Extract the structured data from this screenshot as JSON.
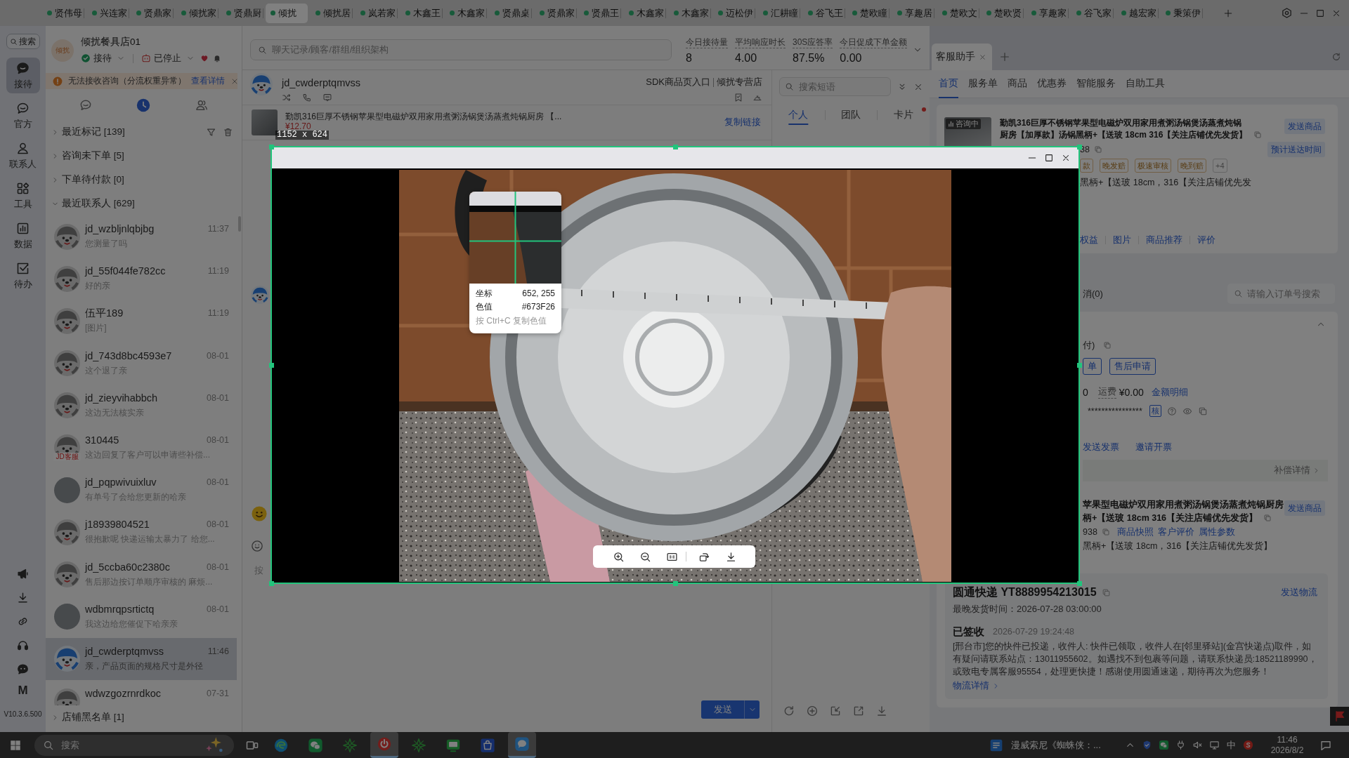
{
  "tab_bar": {
    "tabs": [
      {
        "label": "贤伟母",
        "selected": false
      },
      {
        "label": "兴连家",
        "selected": false
      },
      {
        "label": "贤鼎家",
        "selected": false
      },
      {
        "label": "倾扰家",
        "selected": false
      },
      {
        "label": "贤鼎厨",
        "selected": false
      },
      {
        "label": "倾扰",
        "selected": true
      },
      {
        "label": "倾扰居",
        "selected": false
      },
      {
        "label": "岚若家",
        "selected": false
      },
      {
        "label": "木鑫王",
        "selected": false
      },
      {
        "label": "木鑫家",
        "selected": false
      },
      {
        "label": "贤鼎桌",
        "selected": false
      },
      {
        "label": "贤鼎家",
        "selected": false
      },
      {
        "label": "贤鼎王",
        "selected": false
      },
      {
        "label": "木鑫家",
        "selected": false
      },
      {
        "label": "木鑫家",
        "selected": false
      },
      {
        "label": "迈松伊",
        "selected": false
      },
      {
        "label": "汇耕瞳",
        "selected": false
      },
      {
        "label": "谷飞王",
        "selected": false
      },
      {
        "label": "楚欧瞳",
        "selected": false
      },
      {
        "label": "享趣居",
        "selected": false
      },
      {
        "label": "楚欧文",
        "selected": false
      },
      {
        "label": "楚欧贤",
        "selected": false
      },
      {
        "label": "享趣家",
        "selected": false
      },
      {
        "label": "谷飞家",
        "selected": false
      },
      {
        "label": "越宏家",
        "selected": false
      },
      {
        "label": "秉策伊",
        "selected": false
      }
    ]
  },
  "rail": {
    "search": "搜索",
    "items": [
      {
        "label": "接待",
        "selected": true
      },
      {
        "label": "官方",
        "selected": false
      },
      {
        "label": "联系人",
        "selected": false
      },
      {
        "label": "工具",
        "selected": false
      },
      {
        "label": "数据",
        "selected": false
      },
      {
        "label": "待办",
        "selected": false
      }
    ],
    "brand": "M",
    "version": "V10.3.6.500"
  },
  "shop": {
    "avatar_label": "倾扰",
    "name": "倾扰餐具店01",
    "status": "接待",
    "mode": "已停止"
  },
  "notice": {
    "text": "无法接收咨询（分流权重异常）",
    "link": "查看详情"
  },
  "list_tabs": [
    {
      "selected": false
    },
    {
      "selected": true
    },
    {
      "selected": false
    }
  ],
  "groups": [
    {
      "label": "最近标记 [139]",
      "expanded": false
    },
    {
      "label": "咨询未下单 [5]",
      "expanded": false
    },
    {
      "label": "下单待付款 [0]",
      "expanded": false
    },
    {
      "label": "最近联系人 [629]",
      "expanded": true
    }
  ],
  "contacts": [
    {
      "name": "jd_wzbljnlqbjbg",
      "time": "11:37",
      "preview": "您测量了吗",
      "selected": false,
      "avatar": {
        "kind": "mascot"
      }
    },
    {
      "name": "jd_55f044fe782cc",
      "time": "11:19",
      "preview": "好的亲",
      "selected": false,
      "avatar": {
        "kind": "mascot"
      }
    },
    {
      "name": "伍平189",
      "time": "11:19",
      "preview": "[图片]",
      "selected": false,
      "avatar": {
        "kind": "mascot"
      }
    },
    {
      "name": "jd_743d8bc4593e7",
      "time": "08-01",
      "preview": "这个退了亲",
      "selected": false,
      "avatar": {
        "kind": "mascot"
      }
    },
    {
      "name": "jd_zieyvihabbch",
      "time": "08-01",
      "preview": "这边无法核实亲",
      "selected": false,
      "avatar": {
        "kind": "mascot"
      }
    },
    {
      "name": "310445",
      "time": "08-01",
      "preview": "这边回复了客户可以申请些补偿...",
      "selected": false,
      "avatar": {
        "kind": "service",
        "label": "JD客服"
      }
    },
    {
      "name": "jd_pqpwivuixluv",
      "time": "08-01",
      "preview": "有单号了会给您更新的哈亲",
      "selected": false,
      "avatar": {
        "kind": "photo"
      }
    },
    {
      "name": "j18939804521",
      "time": "08-01",
      "preview": "很抱歉呢 快递运输太暴力了 给您...",
      "selected": false,
      "avatar": {
        "kind": "mascot"
      }
    },
    {
      "name": "jd_5ccba60c2380c",
      "time": "08-01",
      "preview": "售后那边按订单顺序审核的 麻烦...",
      "selected": false,
      "avatar": {
        "kind": "mascot"
      }
    },
    {
      "name": "wdbmrqpsrtictq",
      "time": "08-01",
      "preview": "我这边给您催促下哈亲亲",
      "selected": false,
      "avatar": {
        "kind": "photo"
      }
    },
    {
      "name": "jd_cwderptqmvss",
      "time": "11:46",
      "preview": "亲，产品页面的规格尺寸是外径",
      "selected": true,
      "avatar": {
        "kind": "color"
      }
    },
    {
      "name": "wdwzgozrnrdkoc",
      "time": "07-31",
      "selected": false,
      "avatar": {
        "kind": "mascot"
      }
    }
  ],
  "blacklist": {
    "label": "店铺黑名单 [1]",
    "expanded": false
  },
  "workspace": {
    "search_placeholder": "聊天记录/顾客/群组/组织架构",
    "stats": [
      {
        "label": "今日接待量",
        "value": "8"
      },
      {
        "label": "平均响应时长",
        "value": "4.00"
      },
      {
        "label": "30S应答率",
        "value": "87.5%"
      },
      {
        "label": "今日促成下单金额",
        "value": "0.00"
      }
    ]
  },
  "chat": {
    "customer": "jd_cwderptqmvss",
    "entry": "SDK商品页入口",
    "store": "倾扰专营店",
    "product": {
      "title": "勤凯316巨厚不锈钢苹果型电磁炉双用家用煮粥汤锅煲汤蒸煮炖锅厨房 【...",
      "price": "¥12.70",
      "action": "复制链接"
    },
    "input_hint": "按",
    "send": "发送"
  },
  "quick_replies": {
    "placeholder": "搜索短语",
    "tabs": [
      {
        "label": "个人",
        "selected": true,
        "unread": false
      },
      {
        "label": "团队",
        "selected": false,
        "unread": false
      },
      {
        "label": "卡片",
        "selected": false,
        "unread": true
      }
    ]
  },
  "assistant": {
    "tabs": [
      {
        "label": "客服助手",
        "selected": true
      }
    ],
    "nav": [
      {
        "label": "首页",
        "selected": true
      },
      {
        "label": "服务单",
        "selected": false
      },
      {
        "label": "商品",
        "selected": false
      },
      {
        "label": "优惠券",
        "selected": false
      },
      {
        "label": "智能服务",
        "selected": false
      },
      {
        "label": "自助工具",
        "selected": false
      }
    ],
    "product": {
      "badge": "咨询中",
      "title": "勤凯316巨厚不锈钢苹果型电磁炉双用家用煮粥汤锅煲汤蒸煮炖锅厨房【加厚款】汤锅黑柄+【送玻 18cm 316【关注店铺优先发货】",
      "send": "发送商品",
      "eta": "预计送达时间",
      "sku": "38",
      "tags": [
        {
          "label": "款",
          "kind": "service"
        },
        {
          "label": "晚发赔",
          "kind": "service"
        },
        {
          "label": "极速审核",
          "kind": "service"
        },
        {
          "label": "晚到赔",
          "kind": "service"
        },
        {
          "label": "+4",
          "kind": "more"
        }
      ],
      "spec": "黑柄+【送玻 18cm，316【关注店铺优先发",
      "links": [
        "权益",
        "图片",
        "商品推荐",
        "评价"
      ]
    },
    "orders": {
      "filter": "消(0)",
      "placeholder": "请输入订单号搜索",
      "status": "付)",
      "actions": [
        "单",
        "售后申请"
      ],
      "amount": "0",
      "freight_label": "运费",
      "freight": "¥0.00",
      "detail": "金额明细",
      "masked": "****************",
      "verify": "核",
      "invoice": [
        "发送发票",
        "邀请开票"
      ],
      "compensation": "补偿详情"
    },
    "item": {
      "title": "苹果型电磁炉双用家用煮粥汤锅煲汤蒸煮炖锅厨房",
      "send": "发送商品",
      "variant": "柄+【送玻 18cm 316【关注店铺优先发货】",
      "sku": "938",
      "links": [
        "商品快照",
        "客户评价",
        "属性参数"
      ],
      "spec": "黑柄+【送玻 18cm，316【关注店铺优先发货】"
    },
    "logistics": {
      "carrier": "圆通快递 YT8889954213015",
      "send": "发送物流",
      "deadline": "最晚发货时间：2026-07-28 03:00:00",
      "status": "已签收",
      "status_time": "2026-07-29 19:24:48",
      "detail": "[邢台市]您的快件已投递，收件人: 快件已领取，收件人在[邻里驿站](金宫快递点)取件，如有疑问请联系站点：13011955602。如遇找不到包裹等问题，请联系快递员:18521189990，或致电专属客服95554，处理更快捷！感谢使用圆通速递，期待再次为您服务！",
      "more": "物流详情"
    }
  },
  "viewer": {
    "picker": {
      "coord_label": "坐标",
      "coord": "652, 255",
      "color_label": "色值",
      "hex": "#673F26",
      "hint": "按 Ctrl+C 复制色值"
    }
  },
  "selection_size": "1152 x 624",
  "taskbar": {
    "placeholder": "搜索",
    "apps": [
      {
        "active": false
      },
      {
        "active": false
      },
      {
        "active": false
      },
      {
        "active": true
      },
      {
        "active": false
      },
      {
        "active": false
      },
      {
        "active": false
      },
      {
        "active": true
      }
    ],
    "notification": "漫威索尼《蜘蛛侠：...",
    "ime": "中",
    "time": "11:46",
    "date": "2026/8/2"
  }
}
